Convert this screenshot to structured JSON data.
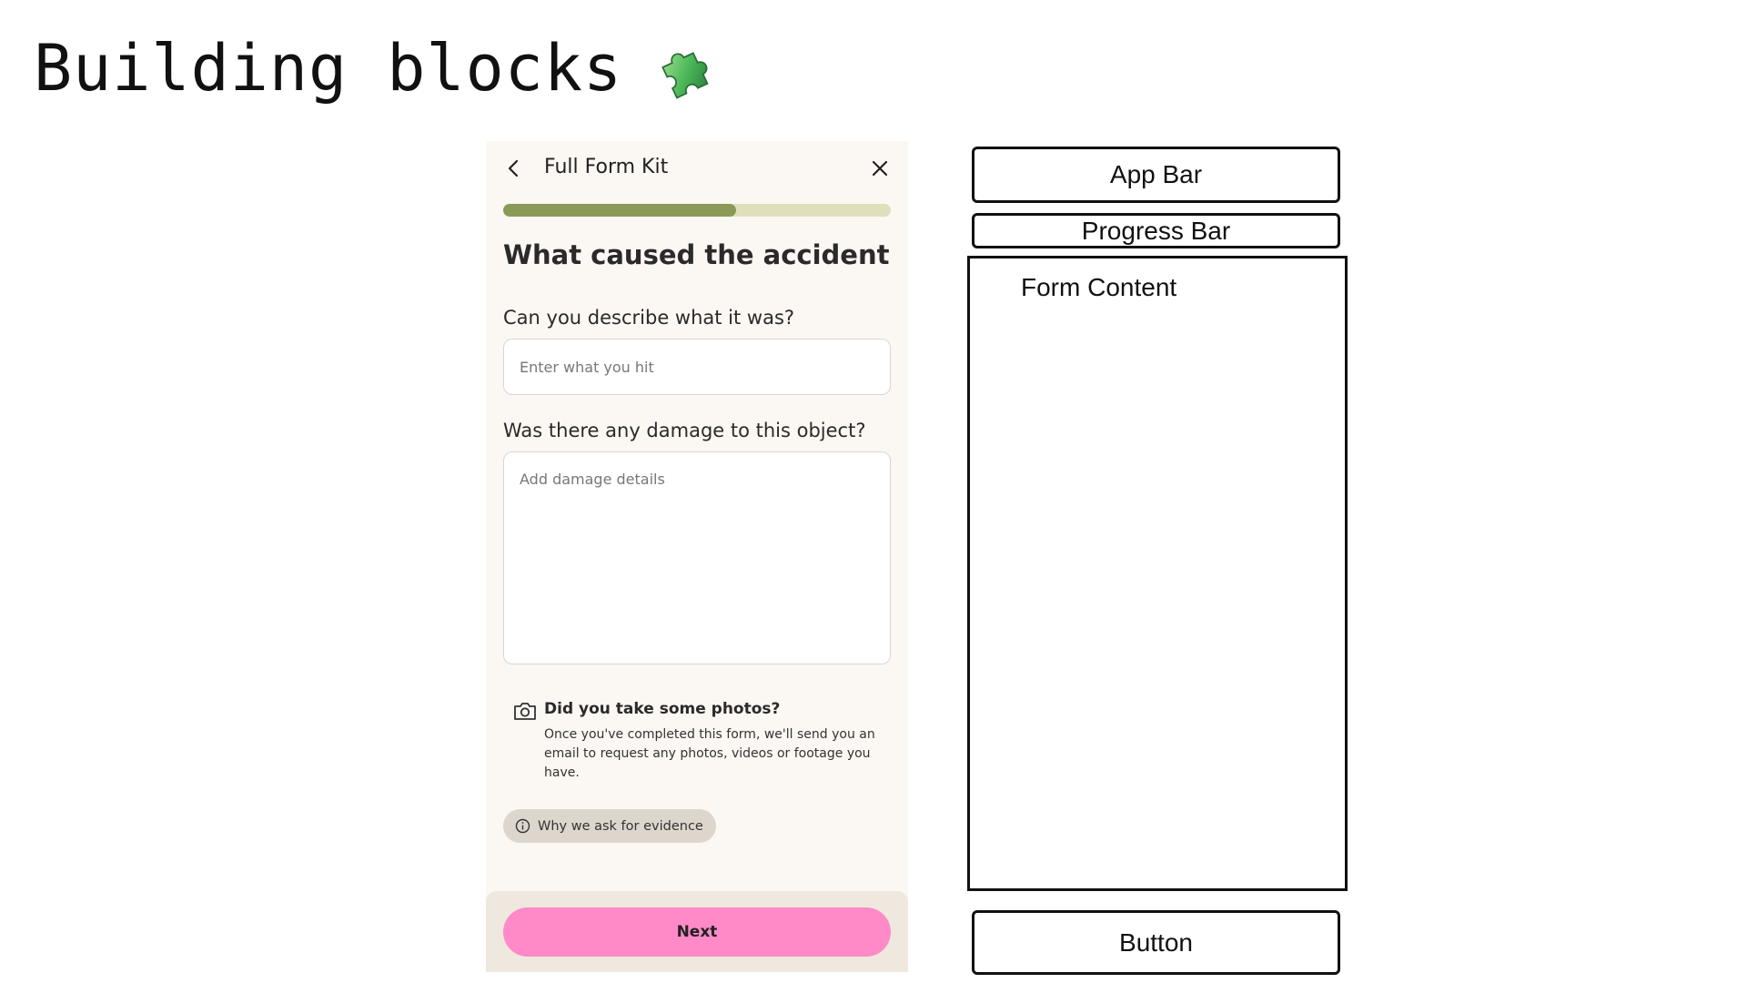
{
  "slide": {
    "title": "Building blocks",
    "title_icon": "puzzle-piece-icon"
  },
  "form": {
    "appbar": {
      "back_icon": "chevron-left-icon",
      "title": "Full Form Kit",
      "close_icon": "close-icon"
    },
    "progress": 0.6,
    "heading": "What caused the accident",
    "fields": [
      {
        "label": "Can you describe what it was?",
        "placeholder": "Enter what you hit",
        "value": ""
      },
      {
        "label": "Was there any damage to this object?",
        "placeholder": "Add damage details",
        "value": ""
      }
    ],
    "photos": {
      "icon": "camera-icon",
      "title": "Did you take some photos?",
      "text": "Once you've completed this form, we'll send you an email to request any photos, videos or footage you have."
    },
    "evidence_chip": {
      "icon": "info-icon",
      "label": "Why we ask for evidence"
    },
    "next_label": "Next"
  },
  "wireframe": {
    "app_bar": "App Bar",
    "progress_bar": "Progress Bar",
    "form_content": "Form Content",
    "button": "Button"
  },
  "colors": {
    "progress_fill": "#8a9a56",
    "progress_track": "#dfe0bb",
    "next_button": "#ff8ac7",
    "phone_background": "#fbf7f3",
    "footer_background": "#efe8de",
    "chip_background": "#ddd6cd"
  }
}
